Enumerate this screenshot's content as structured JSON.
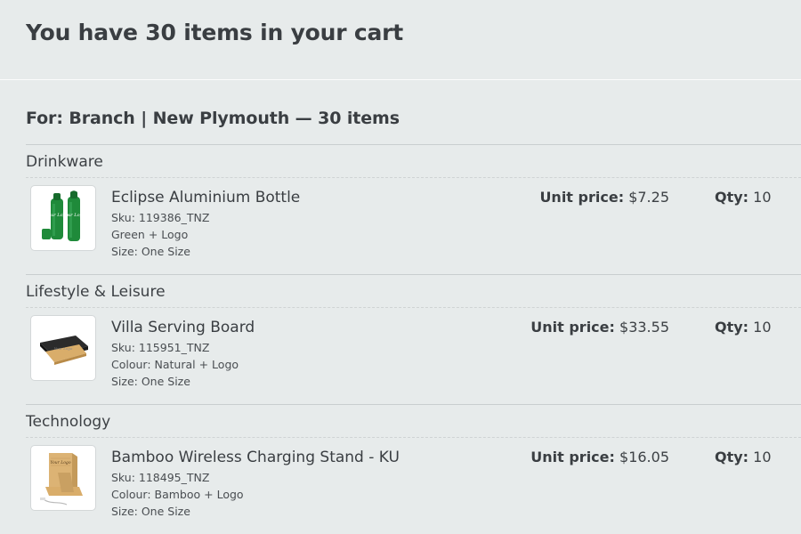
{
  "cart": {
    "title": "You have 30 items in your cart",
    "for_line": "For: Branch | New Plymouth — 30 items"
  },
  "labels": {
    "unit_price": "Unit price:",
    "qty": "Qty:"
  },
  "categories": [
    {
      "name": "Drinkware",
      "product": {
        "name": "Eclipse Aluminium Bottle",
        "sku": "Sku: 119386_TNZ",
        "option": "Green + Logo",
        "size": "Size: One Size",
        "unit_price": "$7.25",
        "qty": "10",
        "image_icon": "green-bottles-icon"
      }
    },
    {
      "name": "Lifestyle & Leisure",
      "product": {
        "name": "Villa Serving Board",
        "sku": "Sku: 115951_TNZ",
        "option": "Colour: Natural + Logo",
        "size": "Size: One Size",
        "unit_price": "$33.55",
        "qty": "10",
        "image_icon": "serving-board-icon"
      }
    },
    {
      "name": "Technology",
      "product": {
        "name": "Bamboo Wireless Charging Stand - KU",
        "sku": "Sku: 118495_TNZ",
        "option": "Colour: Bamboo + Logo",
        "size": "Size: One Size",
        "unit_price": "$16.05",
        "qty": "10",
        "image_icon": "bamboo-stand-icon"
      }
    }
  ],
  "colors": {
    "background": "#e7ebeb",
    "text": "#3a3e42",
    "divider": "#c9cecf",
    "bottle_green": "#1f8a3a",
    "bamboo": "#d9ad6a"
  }
}
